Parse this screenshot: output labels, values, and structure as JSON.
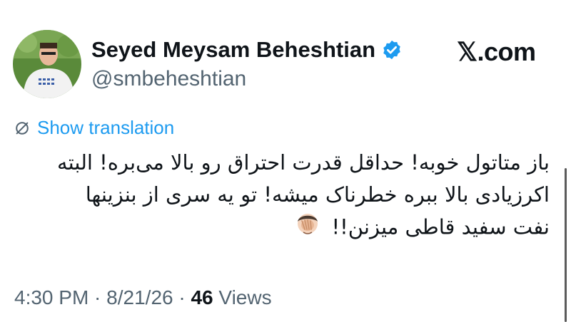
{
  "author": {
    "name": "Seyed Meysam Beheshtian",
    "handle": "@smbeheshtian",
    "verified": true,
    "avatar_icon": "profile-photo"
  },
  "brand": "𝕏.com",
  "translation": {
    "label": "Show translation",
    "icon": "globe-slash-icon"
  },
  "post": {
    "lines": [
      "باز متاتول خوبه! حداقل قدرت احتراق رو بالا می‌بره! البته",
      "اکرزیادی بالا ببره خطرناک میشه! تو یه سری از بنزینها",
      "نفت سفید قاطی میزنن!!"
    ],
    "emoji": "face-palm"
  },
  "meta": {
    "time": "4:30 PM",
    "sep1": " · ",
    "date": "8/21/26",
    "sep2": " · ",
    "views_count": "46",
    "views_label": " Views"
  },
  "colors": {
    "link": "#1d9bf0",
    "muted": "#536471",
    "text": "#0f1419",
    "verified": "#1d9bf0"
  }
}
